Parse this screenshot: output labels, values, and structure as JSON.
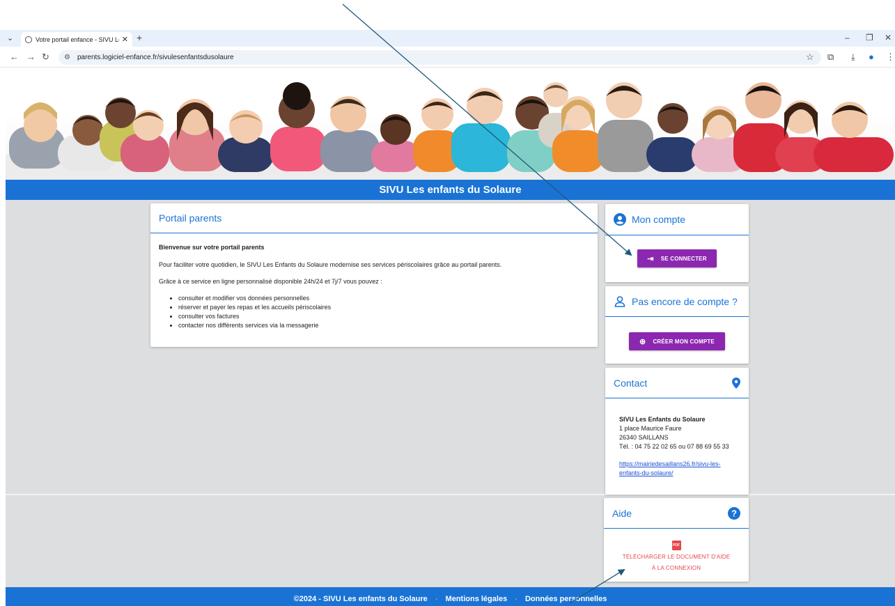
{
  "browser": {
    "tab_title": "Votre portail enfance - SIVU Les",
    "url": "parents.logiciel-enfance.fr/sivulesenfantsdusolaure"
  },
  "header": {
    "title": "SIVU Les enfants du Solaure"
  },
  "main_card": {
    "title": "Portail parents",
    "welcome": "Bienvenue sur votre portail parents",
    "intro": "Pour faciliter votre quotidien, le SIVU Les Enfants du Solaure modernise ses services périscolaires grâce au portail parents.",
    "service_line": "Grâce à ce service en ligne personnalisé disponible 24h/24 et 7j/7 vous pouvez :",
    "items": [
      "consulter et modifier vos données personnelles",
      "réserver et payer les repas et les accueils périscolaires",
      "consulter vos factures",
      "contacter nos différents services via la messagerie"
    ]
  },
  "account": {
    "title": "Mon compte",
    "login_label": "SE CONNECTER"
  },
  "signup": {
    "title": "Pas encore de compte ?",
    "create_label": "CRÉER MON COMPTE"
  },
  "contact": {
    "title": "Contact",
    "org": "SIVU Les Enfants du Solaure",
    "address1": "1 place Maurice Faure",
    "address2": "26340 SAILLANS",
    "phone": "Tél. : 04 75 22 02 65 ou 07 88 69 55 33",
    "link_line1": "https://mairiedesaillans26.fr/sivu-les-",
    "link_line2": "enfants-du-solaure/"
  },
  "help": {
    "title": "Aide",
    "pdf_badge": "PDF",
    "download_line1": "TÉLÉCHARGER LE DOCUMENT D'AIDE",
    "download_line2": "À LA CONNEXION"
  },
  "footer": {
    "copyright": "©2024 - SIVU Les enfants du Solaure",
    "separator": "·",
    "legal": "Mentions légales",
    "privacy": "Données personnelles"
  },
  "colors": {
    "brand_blue": "#1a73d4",
    "button_purple": "#8c27b0",
    "help_red": "#e5484d",
    "annotation_arrow": "#1f5a78"
  }
}
